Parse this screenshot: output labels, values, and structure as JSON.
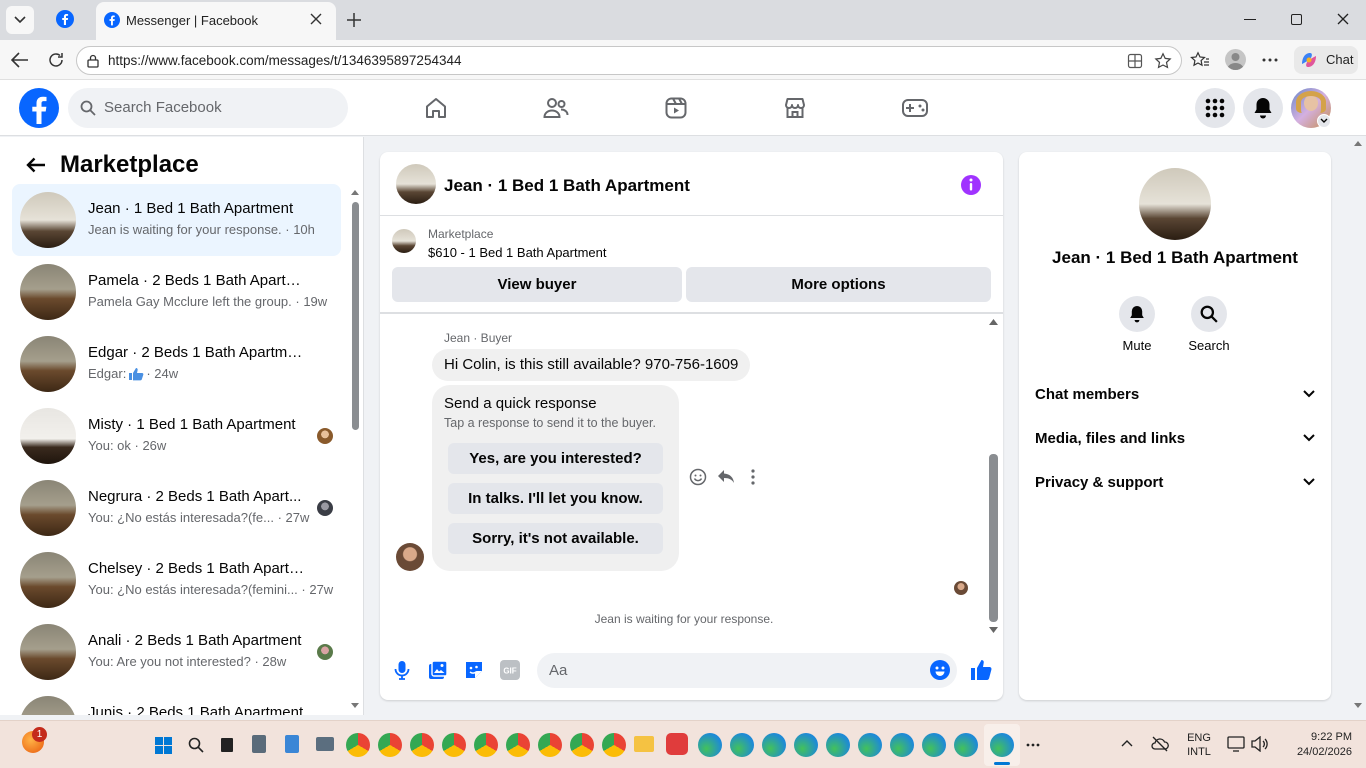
{
  "browser": {
    "tab_title": "Messenger | Facebook",
    "url": "https://www.facebook.com/messages/t/1346395897254344",
    "copilot_label": "Chat"
  },
  "fb": {
    "search_placeholder": "Search Facebook"
  },
  "left": {
    "title": "Marketplace",
    "conversations": [
      {
        "title": "Jean · 1 Bed 1 Bath Apartment",
        "sub": "Jean is waiting for your response. · 10h",
        "selected": true
      },
      {
        "title": "Pamela · 2 Beds 1 Bath Apartment",
        "sub": "Pamela Gay Mcclure left the group. · 19w"
      },
      {
        "title": "Edgar · 2 Beds 1 Bath Apartment",
        "sub_prefix": "Edgar:",
        "sub_suffix": "· 24w"
      },
      {
        "title": "Misty · 1 Bed 1 Bath Apartment",
        "sub": "You: ok · 26w"
      },
      {
        "title": "Negrura · 2 Beds 1 Bath Apart...",
        "sub": "You: ¿No estás interesada?(fe... · 27w"
      },
      {
        "title": "Chelsey · 2 Beds 1 Bath Apartment",
        "sub": "You: ¿No estás interesada?(femini... · 27w"
      },
      {
        "title": "Anali · 2 Beds 1 Bath Apartment",
        "sub": "You: Are you not interested? · 28w"
      },
      {
        "title": "Junis · 2 Beds 1 Bath Apartment",
        "sub": ""
      }
    ]
  },
  "chat": {
    "title": "Jean · 1 Bed 1 Bath Apartment",
    "listing_source": "Marketplace",
    "listing": "$610 - 1 Bed 1 Bath Apartment",
    "view_buyer": "View buyer",
    "more_options": "More options",
    "sender_label": "Jean · Buyer",
    "message": "Hi Colin, is this still available? 970-756-1609",
    "quick_title": "Send a quick response",
    "quick_sub": "Tap a response to send it to the buyer.",
    "quick_responses": [
      "Yes, are you interested?",
      "In talks. I'll let you know.",
      "Sorry, it's not available."
    ],
    "waiting": "Jean is waiting for your response.",
    "composer_placeholder": "Aa"
  },
  "right": {
    "name": "Jean · 1 Bed 1 Bath Apartment",
    "mute": "Mute",
    "search": "Search",
    "sections": [
      "Chat members",
      "Media, files and links",
      "Privacy & support"
    ]
  },
  "taskbar": {
    "notif_badge": "1",
    "lang1": "ENG",
    "lang2": "INTL",
    "time": "9:22 PM",
    "date": "24/02/2026"
  }
}
